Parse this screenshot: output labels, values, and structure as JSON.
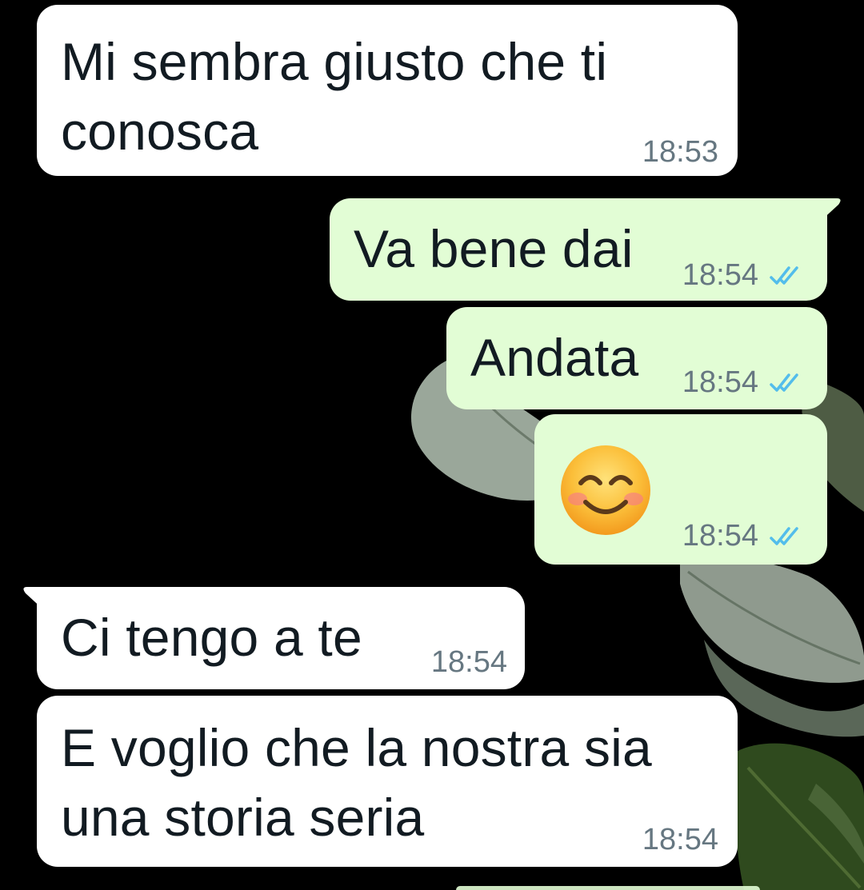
{
  "chat": {
    "messages": [
      {
        "direction": "incoming",
        "lines": [
          "Mi sembra giusto che ti",
          "conosca"
        ],
        "time": "18:53"
      },
      {
        "direction": "outgoing",
        "lines": [
          "Va bene dai"
        ],
        "time": "18:54",
        "status": "read"
      },
      {
        "direction": "outgoing",
        "lines": [
          "Andata"
        ],
        "time": "18:54",
        "status": "read"
      },
      {
        "direction": "outgoing",
        "emoji": "smiling-face-with-smiling-eyes",
        "time": "18:54",
        "status": "read"
      },
      {
        "direction": "incoming",
        "lines": [
          "Ci tengo a te"
        ],
        "time": "18:54"
      },
      {
        "direction": "incoming",
        "lines": [
          "E voglio che la nostra sia",
          "una storia seria"
        ],
        "time": "18:54"
      }
    ]
  },
  "colors": {
    "incoming_bubble": "#ffffff",
    "outgoing_bubble": "#e2fdd5",
    "timestamp": "#667781",
    "read_ticks": "#53bdeb",
    "wallpaper": "#000000"
  },
  "icons": {
    "read_receipt": "double-check-icon",
    "emoji": "smiling-face-emoji"
  }
}
